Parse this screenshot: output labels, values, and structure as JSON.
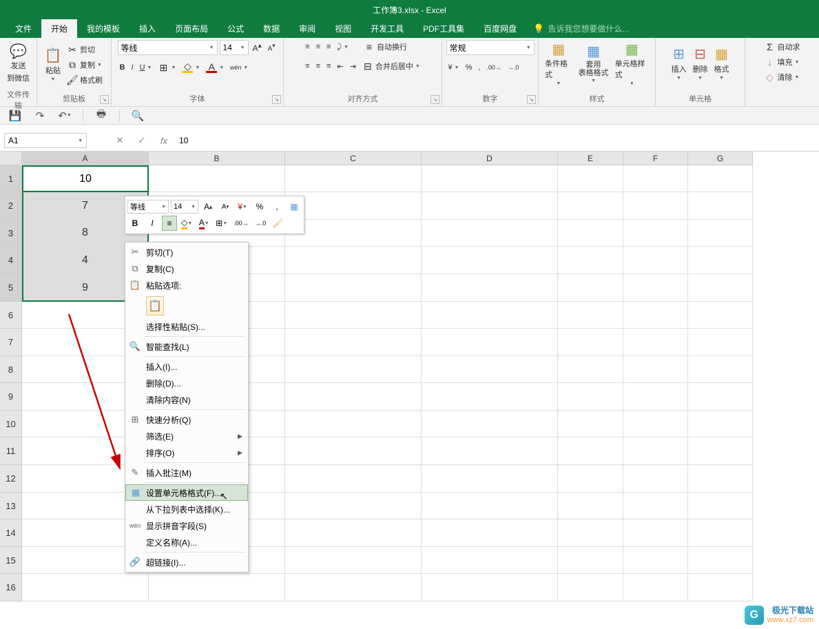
{
  "title": "工作簿3.xlsx - Excel",
  "menu": {
    "file": "文件",
    "home": "开始",
    "template": "我的模板",
    "insert": "插入",
    "layout": "页面布局",
    "formula": "公式",
    "data": "数据",
    "review": "审阅",
    "view": "视图",
    "dev": "开发工具",
    "pdf": "PDF工具集",
    "baidu": "百度网盘",
    "tellme": "告诉我您想要做什么...",
    "tellme_icon": "💡"
  },
  "ribbon": {
    "wechat": {
      "send": "发送",
      "towechat": "到微信",
      "group": "文件传输"
    },
    "clipboard": {
      "paste": "粘贴",
      "cut": "剪切",
      "copy": "复制",
      "formatpainter": "格式刷",
      "group": "剪贴板"
    },
    "font": {
      "name": "等线",
      "size": "14",
      "bold": "B",
      "italic": "I",
      "underline": "U",
      "group": "字体",
      "pinyin": "wén"
    },
    "align": {
      "wrap": "自动换行",
      "merge": "合并后居中",
      "group": "对齐方式"
    },
    "number": {
      "format": "常规",
      "group": "数字"
    },
    "style": {
      "cond": "条件格式",
      "table": "套用\n表格格式",
      "cell": "单元格样式",
      "group": "样式"
    },
    "cells": {
      "insert": "插入",
      "delete": "删除",
      "format": "格式",
      "group": "单元格"
    },
    "edit": {
      "autosum": "自动求",
      "fill": "填充",
      "clear": "清除"
    }
  },
  "namebox": "A1",
  "formula_value": "10",
  "columns": [
    "A",
    "B",
    "C",
    "D",
    "E",
    "F",
    "G"
  ],
  "rows": [
    "1",
    "2",
    "3",
    "4",
    "5",
    "6",
    "7",
    "8",
    "9",
    "10",
    "11",
    "12",
    "13",
    "14",
    "15",
    "16"
  ],
  "cell_data": {
    "A1": "10",
    "A2": "7",
    "A3": "8",
    "A4": "4",
    "A5": "9"
  },
  "mini": {
    "font": "等线",
    "size": "14",
    "percent": "%",
    "comma": ",",
    "bold": "B",
    "italic": "I"
  },
  "context": {
    "cut": "剪切(T)",
    "copy": "复制(C)",
    "paste_options": "粘贴选项:",
    "paste_special": "选择性粘贴(S)...",
    "smart_lookup": "智能查找(L)",
    "insert": "插入(I)...",
    "delete": "删除(D)...",
    "clear": "清除内容(N)",
    "quick_analysis": "快速分析(Q)",
    "filter": "筛选(E)",
    "sort": "排序(O)",
    "comment": "插入批注(M)",
    "format_cells": "设置单元格格式(F)...",
    "dropdown": "从下拉列表中选择(K)...",
    "phonetic": "显示拼音字段(S)",
    "define_name": "定义名称(A)...",
    "hyperlink": "超链接(I)..."
  },
  "watermark": {
    "name": "极光下载站",
    "url": "www.xz7.com"
  }
}
